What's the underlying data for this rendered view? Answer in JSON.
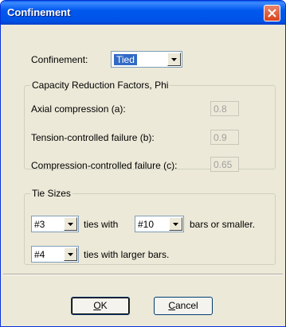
{
  "window": {
    "title": "Confinement"
  },
  "confinement": {
    "label": "Confinement:",
    "value": "Tied"
  },
  "phi": {
    "title": "Capacity Reduction Factors, Phi",
    "rows": [
      {
        "label": "Axial compression (a):",
        "value": "0.8"
      },
      {
        "label": "Tension-controlled failure (b):",
        "value": "0.9"
      },
      {
        "label": "Compression-controlled failure (c):",
        "value": "0.65"
      }
    ]
  },
  "ties": {
    "title": "Tie Sizes",
    "small_tie": "#3",
    "ties_with": "ties with",
    "bar_size": "#10",
    "bars_or_smaller": "bars or smaller.",
    "large_tie": "#4",
    "ties_larger": "ties with larger bars."
  },
  "buttons": {
    "ok_rest": "K",
    "ok_key": "O",
    "cancel_key": "C",
    "cancel_rest": "ancel"
  },
  "icons": {
    "close": "close-icon",
    "dropdown": "chevron-down-icon"
  }
}
